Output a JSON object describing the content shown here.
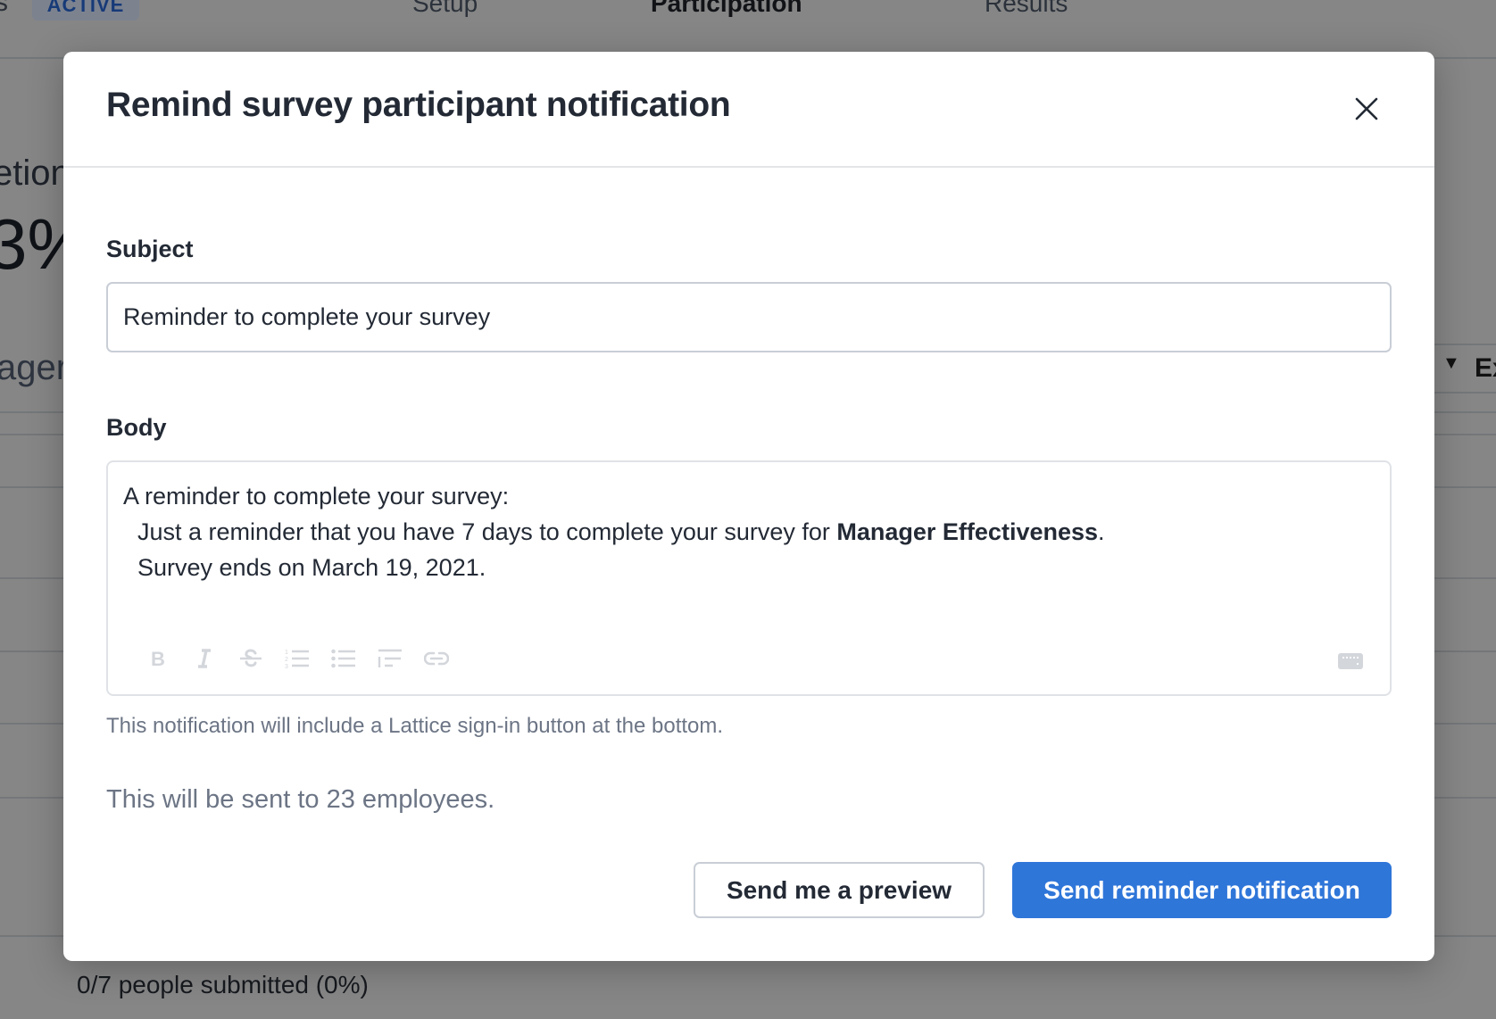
{
  "background_page": {
    "status_badge": "ACTIVE",
    "tabs": [
      {
        "label": "Setup",
        "active": false
      },
      {
        "label": "Participation",
        "active": true
      },
      {
        "label": "Results",
        "active": false
      }
    ],
    "completion_label_fragment": "etion",
    "completion_percent_fragment": "3%",
    "manager_label_fragment": "ager",
    "export_fragment": "Ex",
    "submitted_text": "0/7 people submitted (0%)"
  },
  "modal": {
    "title": "Remind survey participant notification",
    "close_icon": "close-icon",
    "subject": {
      "label": "Subject",
      "value": "Reminder to complete your survey"
    },
    "body": {
      "label": "Body",
      "line1": "A reminder to complete your survey:",
      "line2_prefix": "Just a reminder that you have 7 days to complete your survey for ",
      "line2_bold": "Manager Effectiveness",
      "line2_suffix": ".",
      "line3": "Survey ends on March 19, 2021.",
      "toolbar": [
        {
          "icon": "bold-icon",
          "label": "Bold"
        },
        {
          "icon": "italic-icon",
          "label": "Italic"
        },
        {
          "icon": "strikethrough-icon",
          "label": "Strikethrough"
        },
        {
          "icon": "numbered-list-icon",
          "label": "Numbered list"
        },
        {
          "icon": "bullet-list-icon",
          "label": "Bulleted list"
        },
        {
          "icon": "indent-icon",
          "label": "Indent"
        },
        {
          "icon": "link-icon",
          "label": "Link"
        }
      ],
      "keyboard_icon": "keyboard-icon"
    },
    "helper_text": "This notification will include a Lattice sign-in button at the bottom.",
    "recipients_text": "This will be sent to 23 employees.",
    "buttons": {
      "preview": "Send me a preview",
      "send": "Send reminder notification"
    },
    "colors": {
      "primary": "#2f76d9",
      "text": "#232a35",
      "muted": "#6c7585",
      "icon_disabled": "#d3d6db"
    }
  }
}
